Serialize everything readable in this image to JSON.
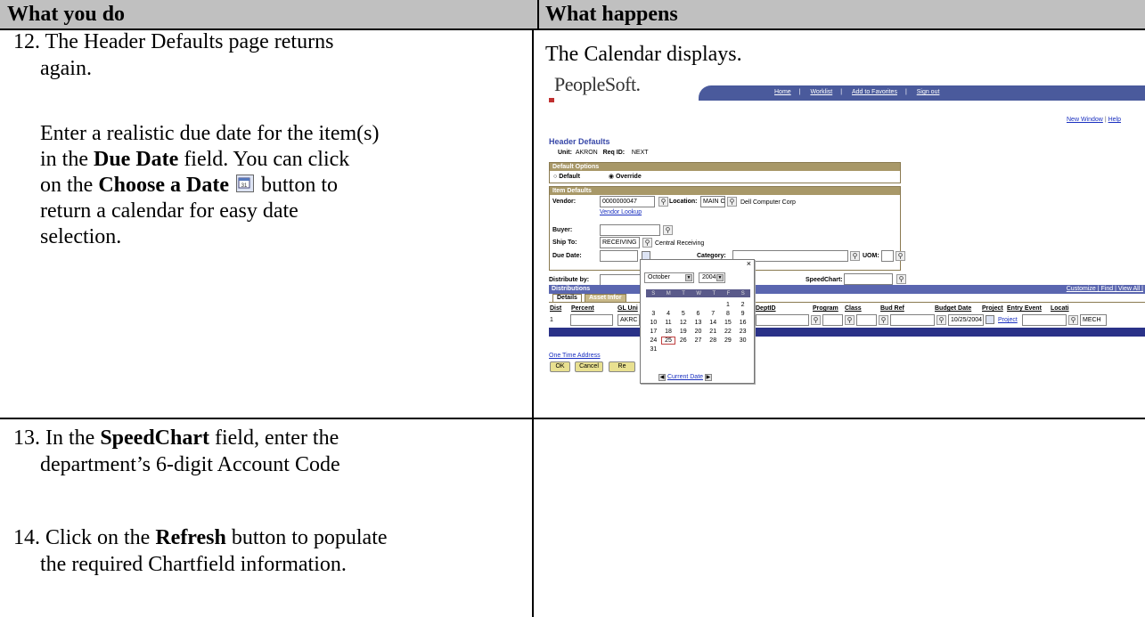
{
  "header": {
    "col1": "What you do",
    "col2": "What happens"
  },
  "rows": [
    {
      "step": "12. The Header Defaults page returns",
      "step_cont": "again.",
      "para": {
        "l1_pre": "Enter a realistic due date for the item(s)",
        "l2_pre": "in the ",
        "l2_bold": "Due Date",
        "l2_post": " field.  You can click",
        "l3_pre": "on the ",
        "l3_bold": "Choose a Date",
        "l3_post": " button to",
        "l4": "return a calendar for easy date",
        "l5": "selection."
      },
      "result": "The Calendar displays."
    },
    {
      "step13_pre": "13. In the ",
      "step13_bold": "SpeedChart",
      "step13_post": " field, enter the",
      "step13_cont": "department’s 6-digit Account Code",
      "step14_pre": "14. Click on the ",
      "step14_bold": "Refresh",
      "step14_post": " button to populate",
      "step14_cont": "the required Chartfield information."
    }
  ],
  "icons": {
    "calendar_button": "calendar-icon"
  },
  "screenshot": {
    "logo": "PeopleSoft.",
    "top_links": [
      "Home",
      "Worklist",
      "Add to Favorites",
      "Sign out"
    ],
    "new_window": "New Window",
    "help": "Help",
    "page_title": "Header Defaults",
    "unit_label": "Unit:",
    "unit_value": "AKRON",
    "reqid_label": "Req ID:",
    "reqid_value": "NEXT",
    "default_options": {
      "title": "Default Options",
      "default": "Default",
      "override": "Override",
      "selected": "Override"
    },
    "item_defaults": {
      "title": "Item Defaults",
      "vendor_label": "Vendor:",
      "vendor_value": "0000000047",
      "location_label": "Location:",
      "location_value": "MAIN OF",
      "vendor_name": "Dell Computer Corp",
      "vendor_lookup": "Vendor Lookup",
      "buyer_label": "Buyer:",
      "shipto_label": "Ship To:",
      "shipto_value": "RECEIVING",
      "shipto_desc": "Central Receiving",
      "duedate_label": "Due Date:",
      "category_label": "Category:",
      "uom_label": "UOM:"
    },
    "distribute_label": "Distribute by:",
    "speedchart_label": "SpeedChart:",
    "distributions": {
      "title": "Distributions",
      "links": "Customize | Find | View All |",
      "tabs": [
        "Details",
        "Asset Infor"
      ],
      "columns": [
        "Dist",
        "Percent",
        "GL Uni",
        "DeptID",
        "Program",
        "Class",
        "Bud Ref",
        "Budget Date",
        "Project",
        "Entry Event",
        "Locati"
      ],
      "row": {
        "dist": "1",
        "gl_unit": "AKRC",
        "budget_date": "10/25/2004",
        "project_link": "Project",
        "location": "MECH"
      }
    },
    "one_time_address": "One Time Address",
    "buttons": {
      "ok": "OK",
      "cancel": "Cancel",
      "refresh": "Re"
    },
    "calendar": {
      "close": "×",
      "month": "October",
      "year": "2004",
      "weekdays": [
        "S",
        "M",
        "T",
        "W",
        "T",
        "F",
        "S"
      ],
      "days": [
        "",
        "",
        "",
        "",
        "",
        "1",
        "2",
        "3",
        "4",
        "5",
        "6",
        "7",
        "8",
        "9",
        "10",
        "11",
        "12",
        "13",
        "14",
        "15",
        "16",
        "17",
        "18",
        "19",
        "20",
        "21",
        "22",
        "23",
        "24",
        "25",
        "26",
        "27",
        "28",
        "29",
        "30",
        "31",
        "",
        "",
        "",
        "",
        "",
        ""
      ],
      "selected_day": "25",
      "current_date": "Current Date"
    }
  }
}
